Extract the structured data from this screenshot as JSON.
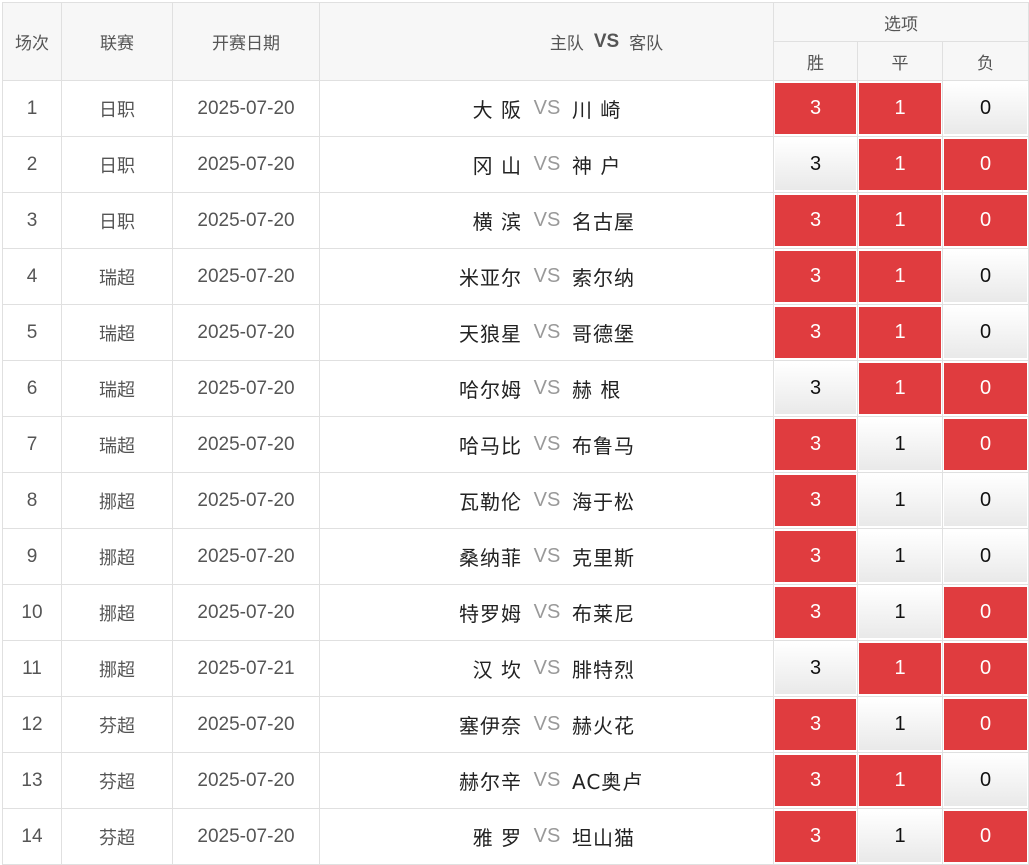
{
  "header": {
    "index": "场次",
    "league": "联赛",
    "date": "开赛日期",
    "home": "主队",
    "vs": "VS",
    "away": "客队",
    "options": "选项",
    "win": "胜",
    "draw": "平",
    "lose": "负"
  },
  "colors": {
    "selected": "#e03c3f",
    "border": "#e0e0e0",
    "header_bg": "#f7f7f7"
  },
  "rows": [
    {
      "idx": "1",
      "league": "日职",
      "date": "2025-07-20",
      "home": "大 阪",
      "vs": "VS",
      "away": "川 崎",
      "o3": "3",
      "o1": "1",
      "o0": "0",
      "sel": [
        true,
        true,
        false
      ]
    },
    {
      "idx": "2",
      "league": "日职",
      "date": "2025-07-20",
      "home": "冈 山",
      "vs": "VS",
      "away": "神 户",
      "o3": "3",
      "o1": "1",
      "o0": "0",
      "sel": [
        false,
        true,
        true
      ]
    },
    {
      "idx": "3",
      "league": "日职",
      "date": "2025-07-20",
      "home": "横 滨",
      "vs": "VS",
      "away": "名古屋",
      "o3": "3",
      "o1": "1",
      "o0": "0",
      "sel": [
        true,
        true,
        true
      ]
    },
    {
      "idx": "4",
      "league": "瑞超",
      "date": "2025-07-20",
      "home": "米亚尔",
      "vs": "VS",
      "away": "索尔纳",
      "o3": "3",
      "o1": "1",
      "o0": "0",
      "sel": [
        true,
        true,
        false
      ]
    },
    {
      "idx": "5",
      "league": "瑞超",
      "date": "2025-07-20",
      "home": "天狼星",
      "vs": "VS",
      "away": "哥德堡",
      "o3": "3",
      "o1": "1",
      "o0": "0",
      "sel": [
        true,
        true,
        false
      ]
    },
    {
      "idx": "6",
      "league": "瑞超",
      "date": "2025-07-20",
      "home": "哈尔姆",
      "vs": "VS",
      "away": "赫 根",
      "o3": "3",
      "o1": "1",
      "o0": "0",
      "sel": [
        false,
        true,
        true
      ]
    },
    {
      "idx": "7",
      "league": "瑞超",
      "date": "2025-07-20",
      "home": "哈马比",
      "vs": "VS",
      "away": "布鲁马",
      "o3": "3",
      "o1": "1",
      "o0": "0",
      "sel": [
        true,
        false,
        true
      ]
    },
    {
      "idx": "8",
      "league": "挪超",
      "date": "2025-07-20",
      "home": "瓦勒伦",
      "vs": "VS",
      "away": "海于松",
      "o3": "3",
      "o1": "1",
      "o0": "0",
      "sel": [
        true,
        false,
        false
      ]
    },
    {
      "idx": "9",
      "league": "挪超",
      "date": "2025-07-20",
      "home": "桑纳菲",
      "vs": "VS",
      "away": "克里斯",
      "o3": "3",
      "o1": "1",
      "o0": "0",
      "sel": [
        true,
        false,
        false
      ]
    },
    {
      "idx": "10",
      "league": "挪超",
      "date": "2025-07-20",
      "home": "特罗姆",
      "vs": "VS",
      "away": "布莱尼",
      "o3": "3",
      "o1": "1",
      "o0": "0",
      "sel": [
        true,
        false,
        true
      ]
    },
    {
      "idx": "11",
      "league": "挪超",
      "date": "2025-07-21",
      "home": "汉 坎",
      "vs": "VS",
      "away": "腓特烈",
      "o3": "3",
      "o1": "1",
      "o0": "0",
      "sel": [
        false,
        true,
        true
      ]
    },
    {
      "idx": "12",
      "league": "芬超",
      "date": "2025-07-20",
      "home": "塞伊奈",
      "vs": "VS",
      "away": "赫火花",
      "o3": "3",
      "o1": "1",
      "o0": "0",
      "sel": [
        true,
        false,
        true
      ]
    },
    {
      "idx": "13",
      "league": "芬超",
      "date": "2025-07-20",
      "home": "赫尔辛",
      "vs": "VS",
      "away": "AC奥卢",
      "o3": "3",
      "o1": "1",
      "o0": "0",
      "sel": [
        true,
        true,
        false
      ]
    },
    {
      "idx": "14",
      "league": "芬超",
      "date": "2025-07-20",
      "home": "雅 罗",
      "vs": "VS",
      "away": "坦山猫",
      "o3": "3",
      "o1": "1",
      "o0": "0",
      "sel": [
        true,
        false,
        true
      ]
    }
  ]
}
